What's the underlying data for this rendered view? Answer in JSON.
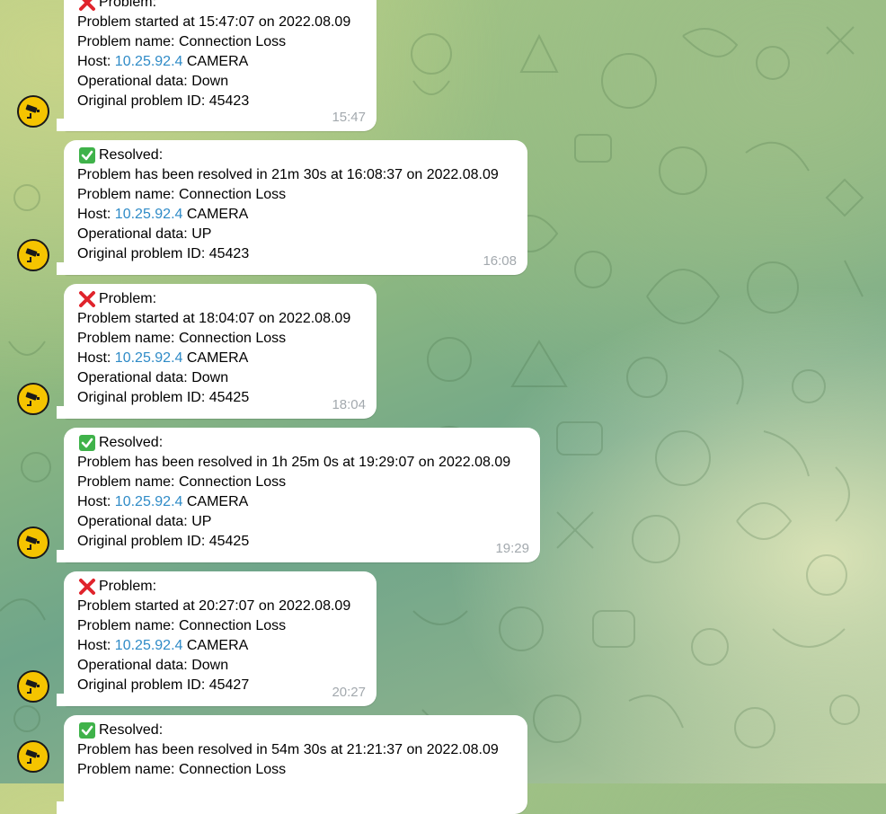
{
  "messages": [
    {
      "kind": "problem",
      "heading": "Problem:",
      "line1": "Problem started at 15:47:07 on 2022.08.09",
      "name": "Problem name: Connection Loss",
      "host_prefix": "Host: ",
      "host_ip": "10.25.92.4",
      "host_suffix": " CAMERA",
      "opdata": "Operational data: Down",
      "id": "Original problem ID: 45423",
      "time": "15:47"
    },
    {
      "kind": "resolved",
      "heading": "Resolved:",
      "line1": "Problem has been resolved in 21m 30s at 16:08:37 on 2022.08.09",
      "name": "Problem name: Connection Loss",
      "host_prefix": "Host: ",
      "host_ip": "10.25.92.4",
      "host_suffix": " CAMERA",
      "opdata": "Operational data: UP",
      "id": "Original problem ID: 45423",
      "time": "16:08"
    },
    {
      "kind": "problem",
      "heading": "Problem:",
      "line1": "Problem started at 18:04:07 on 2022.08.09",
      "name": "Problem name: Connection Loss",
      "host_prefix": "Host: ",
      "host_ip": "10.25.92.4",
      "host_suffix": " CAMERA",
      "opdata": "Operational data: Down",
      "id": "Original problem ID: 45425",
      "time": "18:04"
    },
    {
      "kind": "resolved",
      "heading": "Resolved:",
      "line1": "Problem has been resolved in 1h 25m 0s at 19:29:07 on 2022.08.09",
      "name": "Problem name: Connection Loss",
      "host_prefix": "Host: ",
      "host_ip": "10.25.92.4",
      "host_suffix": " CAMERA",
      "opdata": "Operational data: UP",
      "id": "Original problem ID: 45425",
      "time": "19:29"
    },
    {
      "kind": "problem",
      "heading": "Problem:",
      "line1": "Problem started at 20:27:07 on 2022.08.09",
      "name": "Problem name: Connection Loss",
      "host_prefix": "Host: ",
      "host_ip": "10.25.92.4",
      "host_suffix": " CAMERA",
      "opdata": "Operational data: Down",
      "id": "Original problem ID: 45427",
      "time": "20:27"
    },
    {
      "kind": "resolved",
      "heading": "Resolved:",
      "line1": "Problem has been resolved in 54m 30s at 21:21:37 on 2022.08.09",
      "name": "Problem name: Connection Loss"
    }
  ],
  "colors": {
    "link": "#2f8bc7",
    "problem_mark": "#e0242c",
    "resolved_mark": "#3fb24a",
    "avatar_bg": "#f5c400",
    "timestamp": "#a3a9ae"
  },
  "icons": {
    "problem": "cross-mark-icon",
    "resolved": "check-mark-icon",
    "avatar": "security-camera-icon"
  }
}
